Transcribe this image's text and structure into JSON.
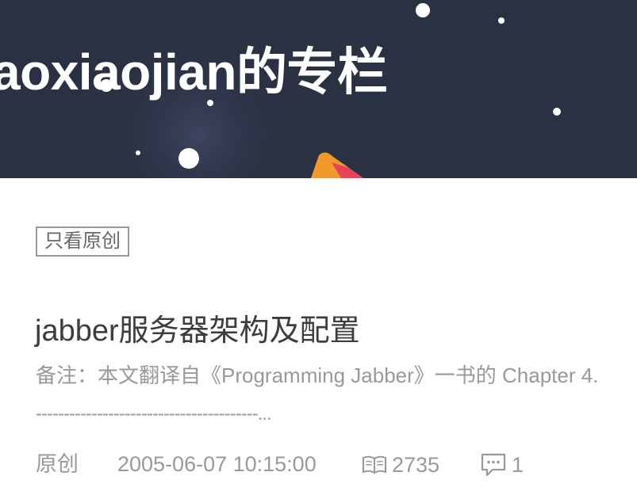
{
  "banner": {
    "title": "aoxiaojian的专栏"
  },
  "filter": {
    "original_only_label": "只看原创"
  },
  "article": {
    "title": "jabber服务器架构及配置",
    "summary": "备注：本文翻译自《Programming Jabber》一书的 Chapter 4.",
    "summary_line2": "----------------------------------------...",
    "type": "原创",
    "date": "2005-06-07 10:15:00",
    "views": "2735",
    "comments": "1"
  },
  "icons": {
    "views": "book-open-icon",
    "comments": "comment-icon"
  },
  "colors": {
    "banner_bg": "#2a3143",
    "text_primary": "#3d3d3d",
    "text_muted": "#999999"
  }
}
